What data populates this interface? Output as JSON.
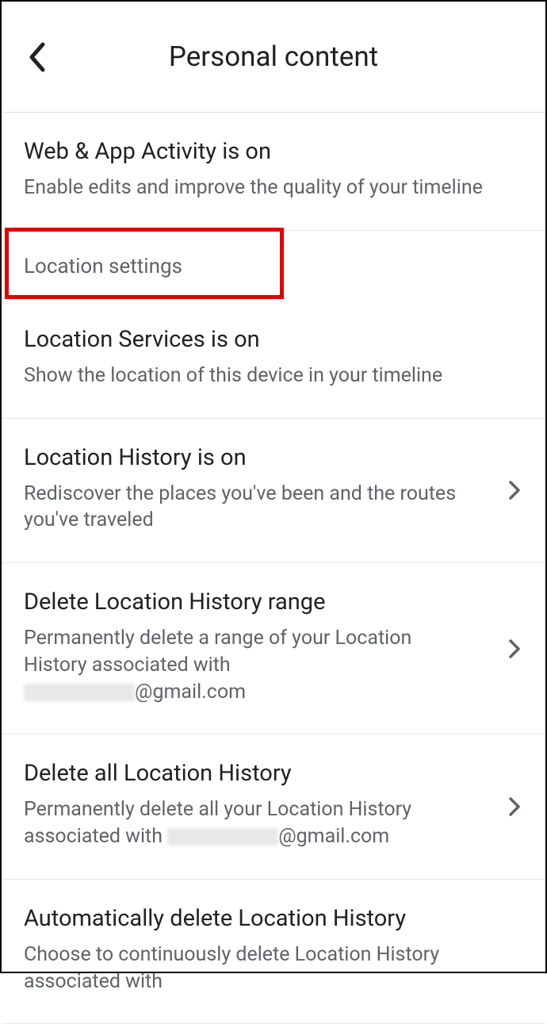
{
  "header": {
    "title": "Personal content"
  },
  "webActivity": {
    "title": "Web & App Activity is on",
    "description": "Enable edits and improve the quality of your timeline"
  },
  "locationSettings": {
    "label": "Location settings"
  },
  "locationServices": {
    "title": "Location Services is on",
    "description": "Show the location of this device in your timeline"
  },
  "locationHistory": {
    "title": "Location History is on",
    "description": "Rediscover the places you've been and the routes you've traveled"
  },
  "deleteRange": {
    "title": "Delete Location History range",
    "descriptionPrefix": "Permanently delete a range of your Location History associated with ",
    "emailSuffix": "@gmail.com"
  },
  "deleteAll": {
    "title": "Delete all Location History",
    "descriptionPrefix": "Permanently delete all your Location History associated with ",
    "emailSuffix": "@gmail.com"
  },
  "autoDelete": {
    "title": "Automatically delete Location History",
    "description": "Choose to continuously delete Location History associated with"
  },
  "highlight": {
    "color": "#e30000"
  }
}
